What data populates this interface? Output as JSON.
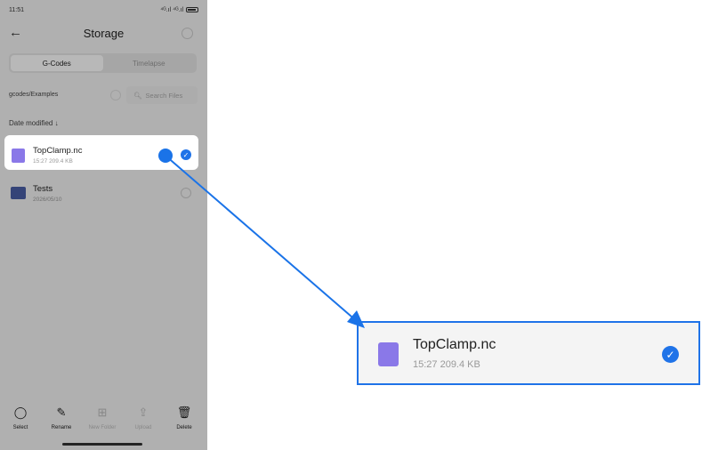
{
  "status_bar": {
    "time": "11:51",
    "signal_text": "⁴ᴳ.ıl ⁴ᴳ.ıl",
    "battery_label": "battery"
  },
  "header": {
    "back_icon": "back-arrow-icon",
    "title": "Storage"
  },
  "tabs": [
    {
      "label": "G-Codes",
      "active": true
    },
    {
      "label": "Timelapse",
      "active": false
    }
  ],
  "path": {
    "label": "gcodes/Examples"
  },
  "search": {
    "placeholder": "Search Files",
    "icon": "search-icon"
  },
  "sort": {
    "label": "Date modified ↓"
  },
  "files": [
    {
      "name": "TopClamp.nc",
      "meta": "15:27  209.4 KB",
      "selected": true,
      "icon": "code-file-icon"
    },
    {
      "name": "Tests",
      "meta": "2026/05/10",
      "selected": false,
      "icon": "folder-icon"
    }
  ],
  "toolbar": [
    {
      "label": "Select",
      "icon": "select-circle-icon",
      "enabled": true
    },
    {
      "label": "Rename",
      "icon": "pencil-icon",
      "enabled": true
    },
    {
      "label": "New Folder",
      "icon": "new-folder-icon",
      "enabled": false
    },
    {
      "label": "Upload",
      "icon": "upload-icon",
      "enabled": false
    },
    {
      "label": "Delete",
      "icon": "trash-icon",
      "enabled": true
    }
  ],
  "zoom": {
    "name": "TopClamp.nc",
    "meta": "15:27  209.4 KB"
  },
  "colors": {
    "accent": "#1f73e8",
    "file_icon": "#8a78e8",
    "folder_icon": "#4a5fa7"
  }
}
